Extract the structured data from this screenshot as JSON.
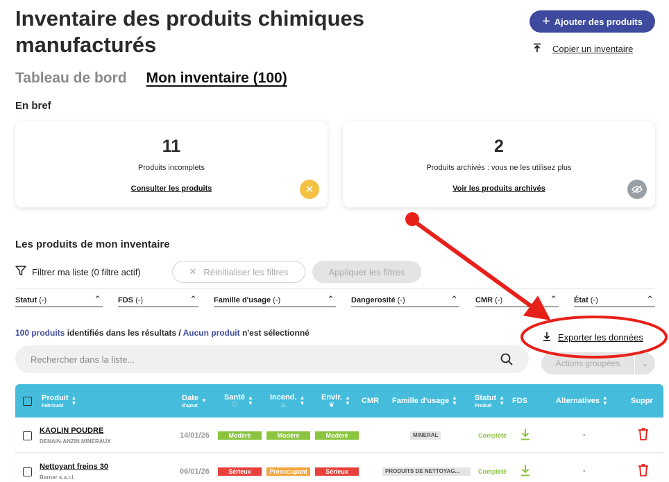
{
  "header": {
    "title": "Inventaire des produits chimiques manufacturés",
    "add_button": "Ajouter des produits",
    "copy_link": "Copier un inventaire"
  },
  "tabs": [
    {
      "label": "Tableau de bord",
      "active": false
    },
    {
      "label": "Mon inventaire (100)",
      "active": true
    }
  ],
  "summary": {
    "label": "En bref",
    "cards": [
      {
        "count": "11",
        "description": "Produits incomplets",
        "link": "Consulter les produits",
        "badge_icon": "close-icon",
        "badge_color": "#f5c143"
      },
      {
        "count": "2",
        "description": "Produits archivés : vous ne les utilisez plus",
        "link": "Voir les produits archivés",
        "badge_icon": "eye-slash-icon",
        "badge_color": "#9a9fa6"
      }
    ]
  },
  "products": {
    "label": "Les produits de mon inventaire",
    "filter_label": "Filtrer ma liste (0 filtre actif)",
    "reset_filters": "Réinitialiser les filtres",
    "apply_filters": "Appliquer les filtres",
    "dropdowns": [
      {
        "name": "Statut",
        "value": "(-)"
      },
      {
        "name": "FDS",
        "value": "(-)"
      },
      {
        "name": "Famille d'usage",
        "value": "(-)"
      },
      {
        "name": "Dangerosité",
        "value": "(-)"
      },
      {
        "name": "CMR",
        "value": "(-)"
      },
      {
        "name": "État",
        "value": "(-)"
      }
    ],
    "results": {
      "count": "100 produits",
      "mid": " identifiés dans les résultats / ",
      "selected": "Aucun produit",
      "end": " n'est sélectionné"
    },
    "export": "Exporter les données",
    "search_placeholder": "Rechercher dans la liste...",
    "bulk_actions": "Actions groupées"
  },
  "table": {
    "headers": {
      "product": "Produit",
      "product_sub": "Fabricant",
      "date": "Date",
      "date_sub": "d'ajout",
      "health": "Santé",
      "fire": "Incend.",
      "env": "Envir.",
      "cmr": "CMR",
      "family": "Famille d'usage",
      "status": "Statut",
      "status_sub": "Produit",
      "fds": "FDS",
      "alternatives": "Alternatives",
      "delete": "Suppr"
    },
    "rows": [
      {
        "name": "KAOLIN POUDRE",
        "maker": "DENAIN-ANZIN MINERAUX",
        "date": "14/01/26",
        "health": {
          "label": "Modéré",
          "color": "#8bc43f"
        },
        "fire": {
          "label": "Modéré",
          "color": "#8bc43f"
        },
        "env": {
          "label": "Modéré",
          "color": "#8bc43f"
        },
        "family": "MINERAL",
        "status": "Complété",
        "alternatives": "-"
      },
      {
        "name": "Nettoyant freins 30",
        "maker": "Berner s.a.r.l.",
        "date": "06/01/26",
        "health": {
          "label": "Sérieux",
          "color": "#e8413c"
        },
        "fire": {
          "label": "Préoccupant",
          "color": "#f5a53a"
        },
        "env": {
          "label": "Sérieux",
          "color": "#e8413c"
        },
        "family": "PRODUITS DE NETTOYAG...",
        "status": "Complété",
        "alternatives": "-"
      }
    ]
  },
  "colors": {
    "primary": "#3d4a9e",
    "table_header": "#45bcdc",
    "annotation": "#e8201a",
    "status_ok": "#8bc43f",
    "delete": "#e8201a"
  }
}
